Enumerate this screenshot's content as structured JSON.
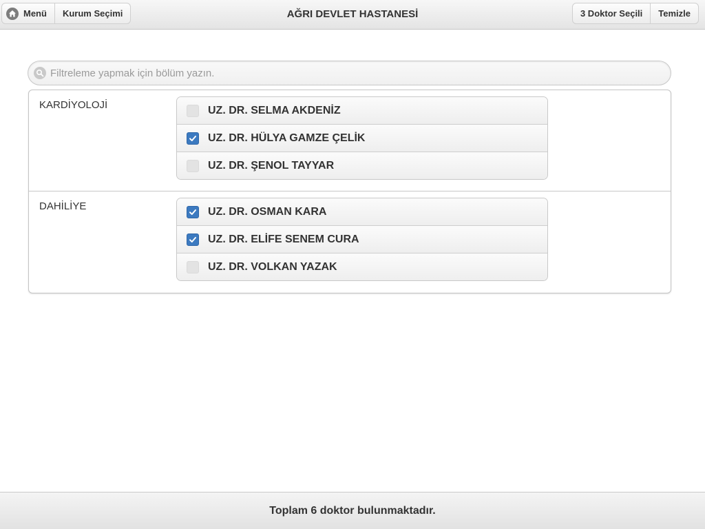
{
  "header": {
    "title": "AĞRI DEVLET HASTANESİ",
    "menu_label": "Menü",
    "institution_label": "Kurum Seçimi",
    "selected_label": "3 Doktor Seçili",
    "clear_label": "Temizle",
    "home_icon": "home-icon"
  },
  "search": {
    "placeholder": "Filtreleme yapmak için bölüm yazın.",
    "value": "",
    "icon": "search-icon"
  },
  "departments": [
    {
      "name": "KARDİYOLOJİ",
      "doctors": [
        {
          "name": "UZ. DR. SELMA AKDENİZ",
          "checked": false
        },
        {
          "name": "UZ. DR. HÜLYA GAMZE ÇELİK",
          "checked": true
        },
        {
          "name": "UZ. DR. ŞENOL TAYYAR",
          "checked": false
        }
      ]
    },
    {
      "name": "DAHİLİYE",
      "doctors": [
        {
          "name": "UZ. DR. OSMAN KARA",
          "checked": true
        },
        {
          "name": "UZ. DR. ELİFE SENEM CURA",
          "checked": true
        },
        {
          "name": "UZ. DR. VOLKAN YAZAK",
          "checked": false
        }
      ]
    }
  ],
  "footer": {
    "text": "Toplam 6 doktor bulunmaktadır."
  },
  "colors": {
    "checkbox_checked": "#3c7ac0",
    "checkbox_unchecked": "#e3e3e3",
    "text": "#333333"
  }
}
